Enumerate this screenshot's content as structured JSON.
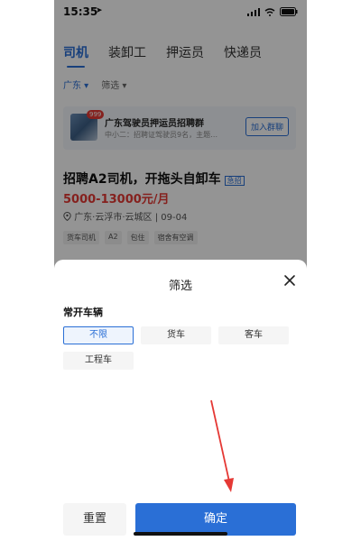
{
  "status_bar": {
    "time": "15:35"
  },
  "tabs": [
    {
      "label": "司机",
      "active": true
    },
    {
      "label": "装卸工",
      "active": false
    },
    {
      "label": "押运员",
      "active": false
    },
    {
      "label": "快递员",
      "active": false
    }
  ],
  "filters": {
    "region": "广东 ▾",
    "other": "筛选 ▾"
  },
  "group_card": {
    "badge": "999",
    "title": "广东驾驶员押运员招聘群",
    "subtitle": "中小二：招聘证驾驶员9名，主题…",
    "join_label": "加入群聊"
  },
  "job": {
    "title": "招聘A2司机，开拖头自卸车",
    "tag": "急招",
    "salary": "5000-13000元/月",
    "location": "广东·云浮市·云城区 | 09-04",
    "tags": [
      "货车司机",
      "A2",
      "包住",
      "宿舍有空调"
    ]
  },
  "sheet": {
    "title": "筛选",
    "section_title": "常开车辆",
    "options": [
      {
        "label": "不限",
        "selected": true
      },
      {
        "label": "货车",
        "selected": false
      },
      {
        "label": "客车",
        "selected": false
      },
      {
        "label": "工程车",
        "selected": false
      }
    ],
    "reset_label": "重置",
    "confirm_label": "确定"
  },
  "colors": {
    "accent": "#2a6fd6",
    "salary": "#e53935",
    "arrow": "#e53935"
  },
  "icons": [
    "location-arrow-icon",
    "signal-icon",
    "wifi-icon",
    "battery-icon",
    "pin-icon",
    "close-icon"
  ]
}
